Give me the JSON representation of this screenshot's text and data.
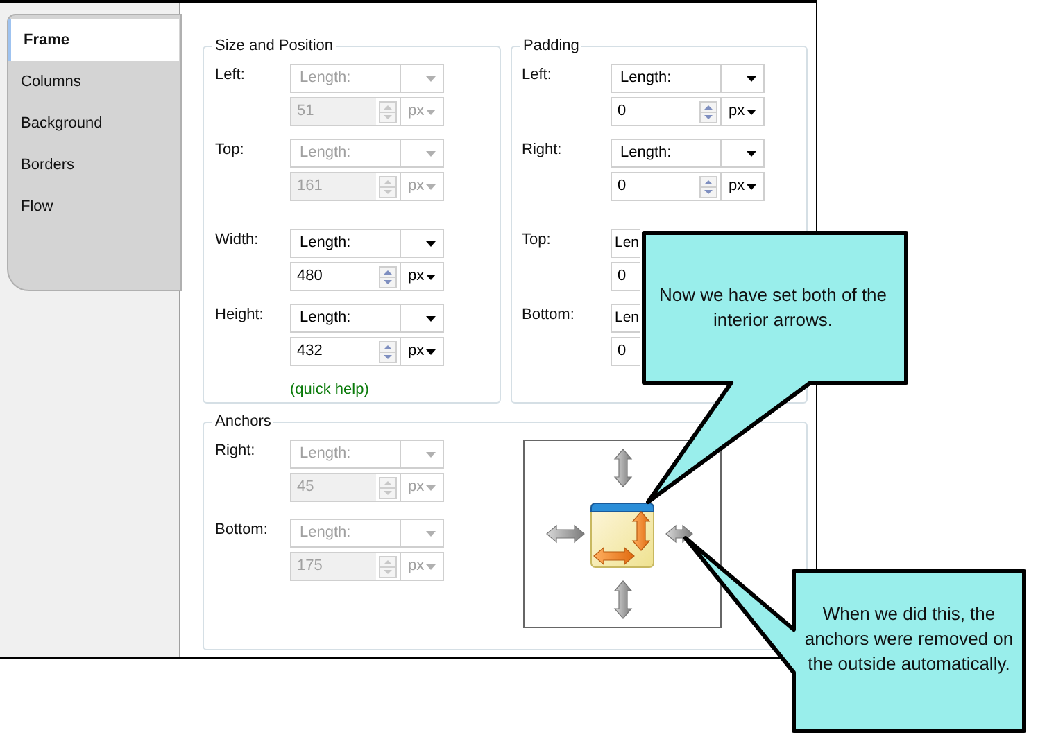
{
  "tabs": [
    {
      "label": "Frame",
      "selected": true
    },
    {
      "label": "Columns",
      "selected": false
    },
    {
      "label": "Background",
      "selected": false
    },
    {
      "label": "Borders",
      "selected": false
    },
    {
      "label": "Flow",
      "selected": false
    }
  ],
  "size_and_position": {
    "title": "Size and Position",
    "rows": [
      {
        "label": "Left:",
        "unit_type": "Length:",
        "value": "51",
        "unit": "px",
        "disabled": true
      },
      {
        "label": "Top:",
        "unit_type": "Length:",
        "value": "161",
        "unit": "px",
        "disabled": true
      },
      {
        "label": "Width:",
        "unit_type": "Length:",
        "value": "480",
        "unit": "px",
        "disabled": false
      },
      {
        "label": "Height:",
        "unit_type": "Length:",
        "value": "432",
        "unit": "px",
        "disabled": false
      }
    ],
    "help_link": "(quick help)"
  },
  "padding": {
    "title": "Padding",
    "rows": [
      {
        "label": "Left:",
        "unit_type": "Length:",
        "value": "0",
        "unit": "px",
        "disabled": false
      },
      {
        "label": "Right:",
        "unit_type": "Length:",
        "value": "0",
        "unit": "px",
        "disabled": false
      },
      {
        "label": "Top:",
        "unit_type": "Len",
        "value": "0",
        "disabled": false
      },
      {
        "label": "Bottom:",
        "unit_type": "Len",
        "value": "0",
        "disabled": false
      }
    ]
  },
  "anchors": {
    "title": "Anchors",
    "rows": [
      {
        "label": "Right:",
        "unit_type": "Length:",
        "value": "45",
        "unit": "px",
        "disabled": true
      },
      {
        "label": "Bottom:",
        "unit_type": "Length:",
        "value": "175",
        "unit": "px",
        "disabled": true
      }
    ]
  },
  "callouts": [
    {
      "text": "Now we have set both of the interior arrows."
    },
    {
      "text": "When we did this, the anchors were removed on the outside automatically."
    }
  ]
}
